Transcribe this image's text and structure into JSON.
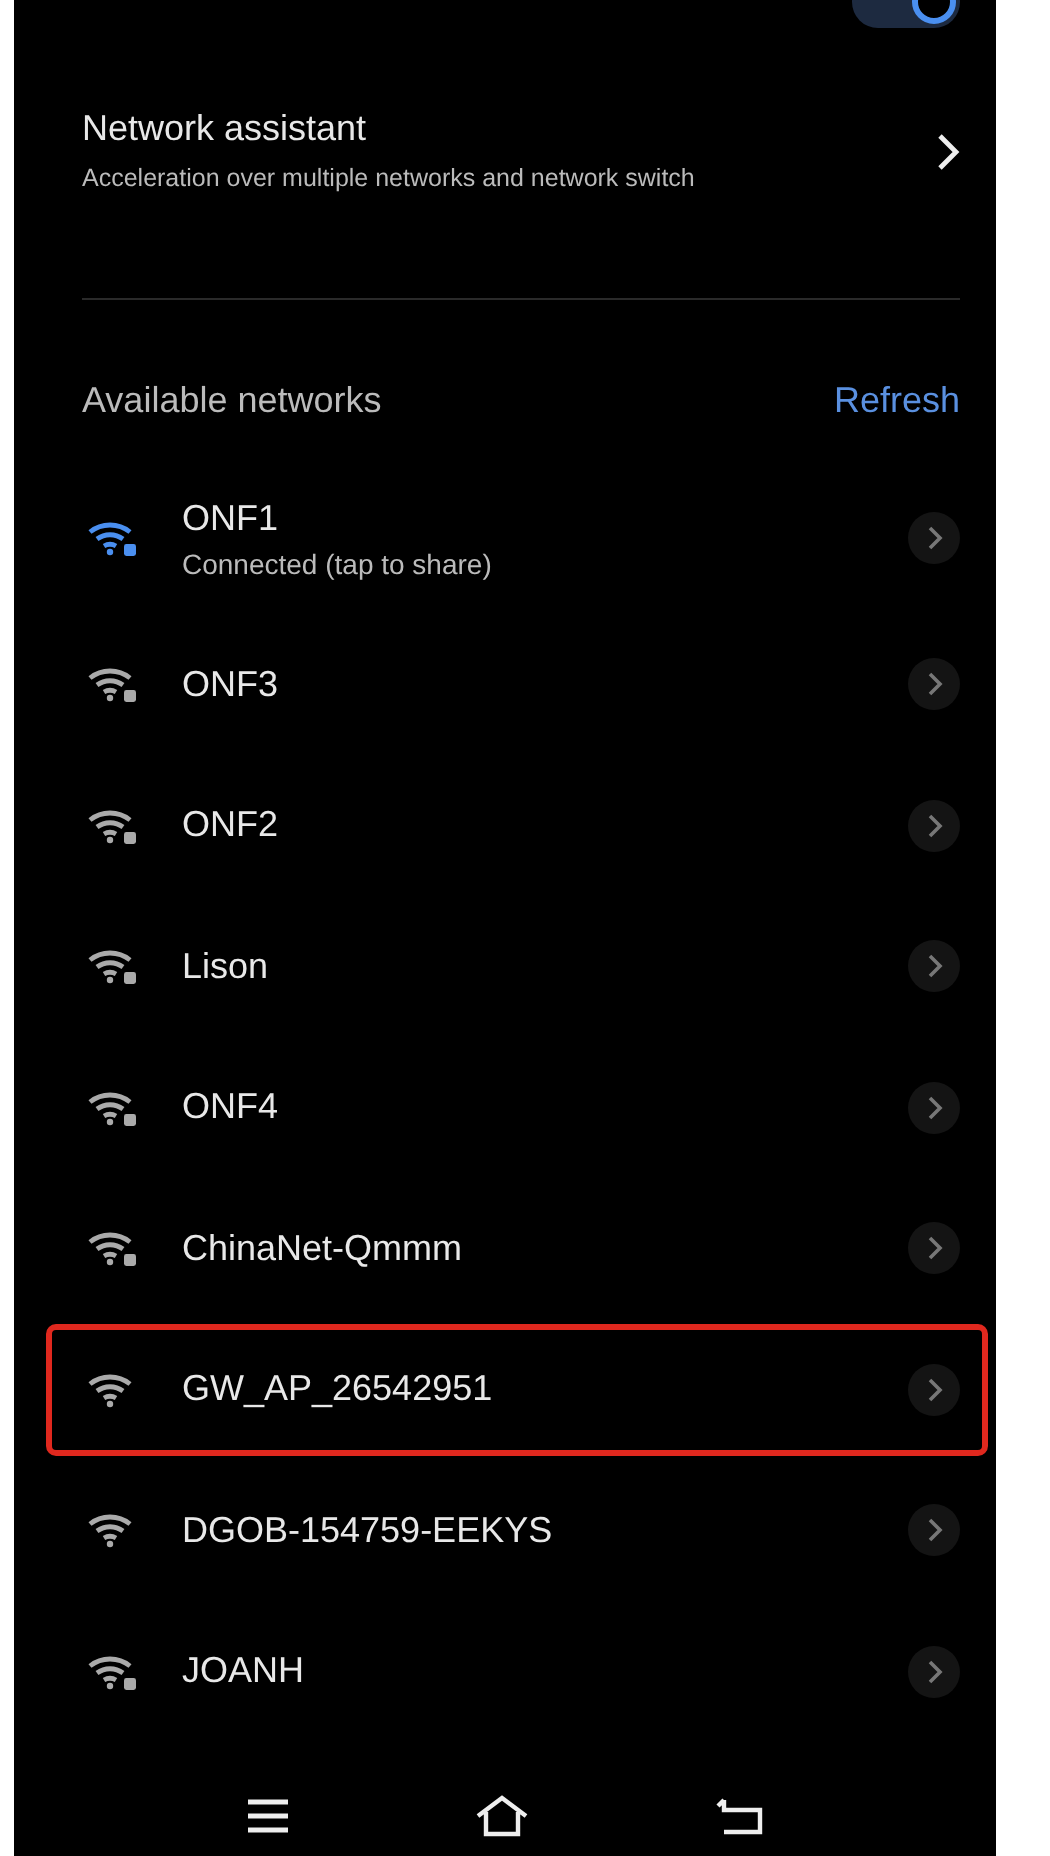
{
  "wifi_toggle": {
    "on": true
  },
  "network_assistant": {
    "title": "Network assistant",
    "subtitle": "Acceleration over multiple networks and network switch"
  },
  "available": {
    "heading": "Available networks",
    "refresh": "Refresh"
  },
  "networks": [
    {
      "name": "ONF1",
      "status": "Connected (tap to share)",
      "connected": true,
      "secured": true,
      "highlighted": false
    },
    {
      "name": "ONF3",
      "connected": false,
      "secured": true,
      "highlighted": false
    },
    {
      "name": "ONF2",
      "connected": false,
      "secured": true,
      "highlighted": false
    },
    {
      "name": "Lison",
      "connected": false,
      "secured": true,
      "highlighted": false
    },
    {
      "name": "ONF4",
      "connected": false,
      "secured": true,
      "highlighted": false
    },
    {
      "name": "ChinaNet-Qmmm",
      "connected": false,
      "secured": true,
      "highlighted": false
    },
    {
      "name": "GW_AP_26542951",
      "connected": false,
      "secured": false,
      "highlighted": true
    },
    {
      "name": "DGOB-154759-EEKYS",
      "connected": false,
      "secured": false,
      "highlighted": false
    },
    {
      "name": "JOANH",
      "connected": false,
      "secured": true,
      "highlighted": false
    }
  ]
}
